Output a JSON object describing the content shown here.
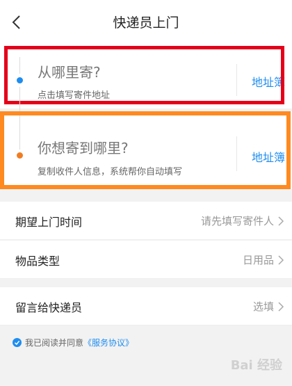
{
  "header": {
    "title": "快递员上门"
  },
  "sender": {
    "question": "从哪里寄?",
    "hint": "点击填写寄件地址",
    "address_book": "地址簿"
  },
  "receiver": {
    "question": "你想寄到哪里?",
    "hint": "复制收件人信息，系统帮你自动填写",
    "address_book": "地址簿"
  },
  "fields": [
    {
      "label": "期望上门时间",
      "value": "请先填写寄件人"
    },
    {
      "label": "物品类型",
      "value": "日用品"
    },
    {
      "label": "留言给快递员",
      "value": "选填"
    }
  ],
  "agreement": {
    "prefix": "我已阅读并同意",
    "link": "《服务协议》"
  },
  "watermark": "Bai 经验",
  "colors": {
    "accent": "#1f8df0",
    "highlight_red": "#e5001a",
    "highlight_orange": "#ff8a1f",
    "receiver_dot": "#f07d22"
  }
}
